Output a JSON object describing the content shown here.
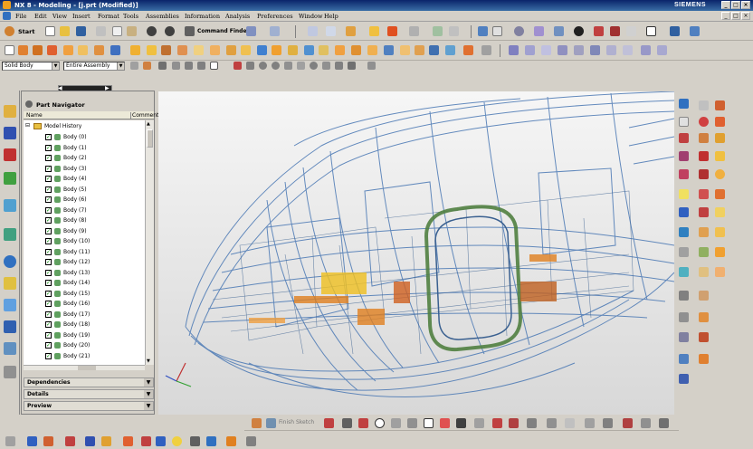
{
  "app": {
    "title": "NX 8 - Modeling - [j.prt (Modified)]",
    "brand": "SIEMENS",
    "win_buttons": [
      "_",
      "□",
      "×"
    ]
  },
  "menu": [
    "File",
    "Edit",
    "View",
    "Insert",
    "Format",
    "Tools",
    "Assemblies",
    "Information",
    "Analysis",
    "Preferences",
    "Window",
    "Help"
  ],
  "toolbar": {
    "start_label": "Start",
    "command_finder_label": "Command Finder"
  },
  "selection": {
    "filter_value": "Solid Body",
    "scope_value": "Entire Assembly"
  },
  "navigator": {
    "title": "Part Navigator",
    "columns": {
      "name": "Name",
      "comment": "Comment"
    },
    "root": "Model History",
    "items": [
      "Body (0)",
      "Body (1)",
      "Body (2)",
      "Body (3)",
      "Body (4)",
      "Body (5)",
      "Body (6)",
      "Body (7)",
      "Body (8)",
      "Body (9)",
      "Body (10)",
      "Body (11)",
      "Body (12)",
      "Body (13)",
      "Body (14)",
      "Body (15)",
      "Body (16)",
      "Body (17)",
      "Body (18)",
      "Body (19)",
      "Body (20)",
      "Body (21)"
    ],
    "panels": [
      "Dependencies",
      "Details",
      "Preview"
    ]
  },
  "bottom": {
    "sketch_label": "Finish Sketch"
  },
  "colors": {
    "title_bar": "#0a246a",
    "wireframe": "#4a78b4",
    "highlight_orange": "#e08020",
    "highlight_yellow": "#f0c020",
    "highlight_green": "#508040"
  }
}
